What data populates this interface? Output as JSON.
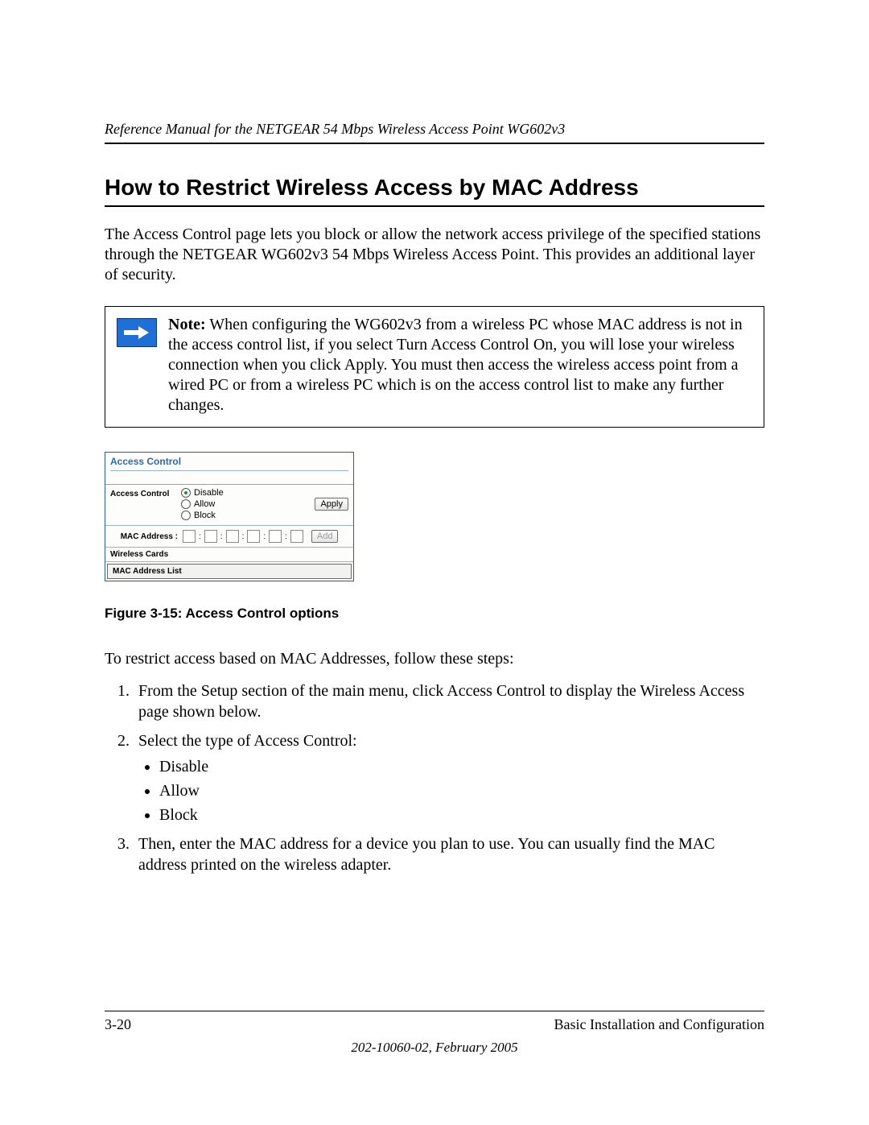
{
  "header": {
    "running_head": "Reference Manual for the NETGEAR 54 Mbps Wireless Access Point WG602v3"
  },
  "title": "How to Restrict Wireless Access by MAC Address",
  "intro": "The Access Control page lets you block or allow the network access privilege of the specified stations through the NETGEAR WG602v3 54 Mbps Wireless Access Point. This provides an additional layer of security.",
  "note": {
    "label": "Note:",
    "text": " When configuring the WG602v3 from a wireless PC whose MAC address is not in the access control list, if you select Turn Access Control On, you will lose your wireless connection when you click Apply. You must then access the wireless access point from a wired PC or from a wireless PC which is on the access control list to make any further changes."
  },
  "ui": {
    "panel_title": "Access Control",
    "row_label": "Access Control",
    "radios": {
      "disable": "Disable",
      "allow": "Allow",
      "block": "Block"
    },
    "apply": "Apply",
    "mac_label": "MAC Address :",
    "add": "Add",
    "wireless_cards": "Wireless Cards",
    "mac_list": "MAC Address List"
  },
  "figure_caption": "Figure 3-15:  Access Control options",
  "steps": {
    "intro": "To restrict access based on MAC Addresses, follow these steps:",
    "s1": "From the Setup section of the main menu, click Access Control to display the Wireless Access page shown below.",
    "s2_head": "Select the type of Access Control:",
    "s2_items": {
      "a": "Disable",
      "b": "Allow",
      "c": "Block"
    },
    "s3": "Then, enter the MAC address for a device you plan to use. You can usually find the MAC address printed on the wireless adapter."
  },
  "footer": {
    "page": "3-20",
    "section": "Basic Installation and Configuration",
    "docid": "202-10060-02, February 2005"
  }
}
